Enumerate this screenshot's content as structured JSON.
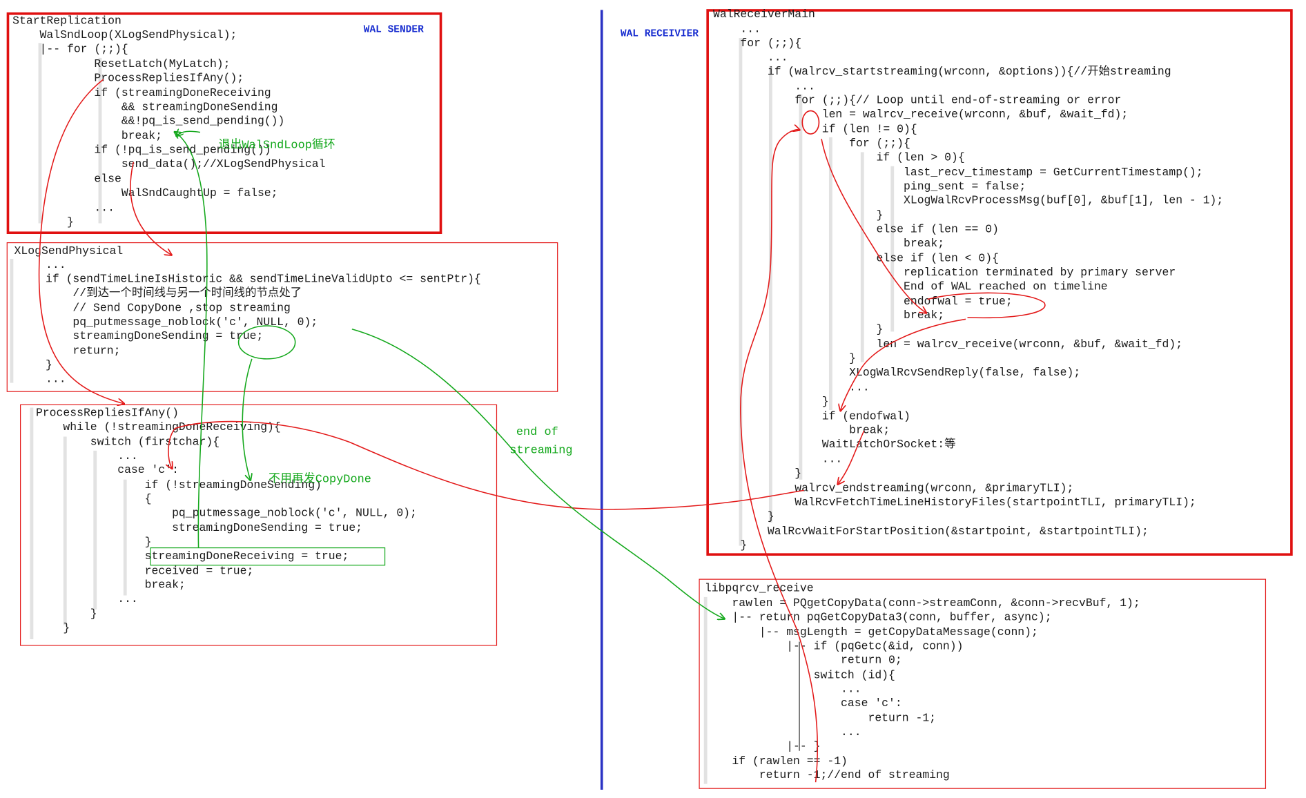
{
  "labels": {
    "wal_sender": "WAL SENDER",
    "wal_receiver": "WAL RECEIVIER",
    "exit_loop": "退出WalSndLoop循环",
    "no_resend": "不用再发CopyDone",
    "end_of_streaming_1": "end of",
    "end_of_streaming_2": "streaming"
  },
  "colors": {
    "red_arrow": "#e31a1a",
    "green_arrow": "#14a81c",
    "blue_circle": "#1f3ad0",
    "divider": "#2b33c4"
  },
  "sender": {
    "lines": [
      "StartReplication",
      "    WalSndLoop(XLogSendPhysical);",
      "    |-- for (;;){",
      "            ResetLatch(MyLatch);",
      "            ProcessRepliesIfAny();",
      "            if (streamingDoneReceiving",
      "                && streamingDoneSending",
      "                &&!pq_is_send_pending())",
      "                break;",
      "            if (!pq_is_send_pending())",
      "                send_data();//XLogSendPhysical",
      "            else",
      "                WalSndCaughtUp = false;",
      "            ...",
      "        }"
    ]
  },
  "xlog_send_physical": {
    "lines": [
      "XLogSendPhysical",
      "    ...",
      "    if (sendTimeLineIsHistoric && sendTimeLineValidUpto <= sentPtr){",
      "        //到达一个时间线与另一个时间线的节点处了",
      "        // Send CopyDone ,stop streaming",
      "        pq_putmessage_noblock('c', NULL, 0);",
      "        streamingDoneSending = true;",
      "        return;",
      "    }",
      "    ..."
    ]
  },
  "process_replies": {
    "lines": [
      "ProcessRepliesIfAny()",
      "    while (!streamingDoneReceiving){",
      "        switch (firstchar){",
      "            ...",
      "            case 'c':",
      "                if (!streamingDoneSending)",
      "                {",
      "                    pq_putmessage_noblock('c', NULL, 0);",
      "                    streamingDoneSending = true;",
      "                }",
      "                streamingDoneReceiving = true;",
      "                received = true;",
      "                break;",
      "            ...",
      "        }",
      "    }"
    ]
  },
  "receiver": {
    "lines": [
      "WalReceiverMain",
      "    ...",
      "    for (;;){",
      "        ...",
      "        if (walrcv_startstreaming(wrconn, &options)){//开始streaming",
      "            ...",
      "            for (;;){// Loop until end-of-streaming or error",
      "                len = walrcv_receive(wrconn, &buf, &wait_fd);",
      "                if (len != 0){",
      "                    for (;;){",
      "                        if (len > 0){",
      "                            last_recv_timestamp = GetCurrentTimestamp();",
      "                            ping_sent = false;",
      "                            XLogWalRcvProcessMsg(buf[0], &buf[1], len - 1);",
      "                        }",
      "                        else if (len == 0)",
      "                            break;",
      "                        else if (len < 0){",
      "                            replication terminated by primary server",
      "                            End of WAL reached on timeline",
      "                            endofwal = true;",
      "                            break;",
      "                        }",
      "                        len = walrcv_receive(wrconn, &buf, &wait_fd);",
      "                    }",
      "                    XLogWalRcvSendReply(false, false);",
      "                    ...",
      "                }",
      "                if (endofwal)",
      "                    break;",
      "                WaitLatchOrSocket:等",
      "                ...",
      "            }",
      "            walrcv_endstreaming(wrconn, &primaryTLI);",
      "            WalRcvFetchTimeLineHistoryFiles(startpointTLI, primaryTLI);",
      "        }",
      "        WalRcvWaitForStartPosition(&startpoint, &startpointTLI);",
      "    }"
    ]
  },
  "libpq": {
    "lines": [
      "libpqrcv_receive",
      "    rawlen = PQgetCopyData(conn->streamConn, &conn->recvBuf, 1);",
      "    |-- return pqGetCopyData3(conn, buffer, async);",
      "        |-- msgLength = getCopyDataMessage(conn);",
      "            |-- if (pqGetc(&id, conn))",
      "                    return 0;",
      "                switch (id){",
      "                    ...",
      "                    case 'c':",
      "                        return -1;",
      "                    ...",
      "            |-- }",
      "    if (rawlen == -1)",
      "        return -1;//end of streaming"
    ]
  }
}
